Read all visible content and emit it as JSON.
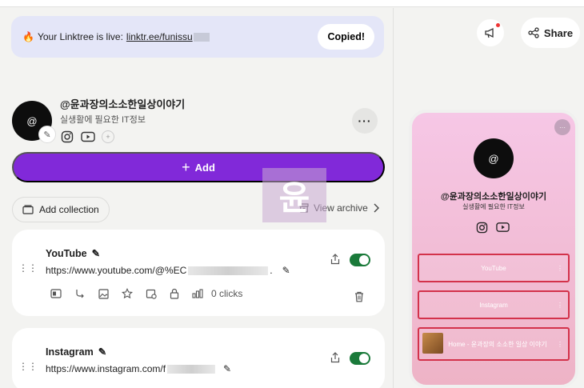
{
  "banner": {
    "prefix": "Your Linktree is live:",
    "link": "linktr.ee/funissu",
    "copied_label": "Copied!"
  },
  "profile": {
    "avatar_text": "@",
    "name": "@윤과장의소소한일상이야기",
    "bio": "실생활에 필요한 IT정보"
  },
  "actions": {
    "add_label": "Add",
    "collection_label": "Add collection",
    "archive_label": "View archive"
  },
  "links": [
    {
      "title": "YouTube",
      "url": "https://www.youtube.com/@%EC",
      "url_suffix": ".",
      "clicks": "0 clicks"
    },
    {
      "title": "Instagram",
      "url": "https://www.instagram.com/f"
    }
  ],
  "header": {
    "share_label": "Share"
  },
  "watermark": "윤",
  "preview": {
    "avatar_text": "@",
    "name": "@윤과장의소소한일상이야기",
    "bio": "실생활에 필요한 IT정보",
    "links": [
      {
        "label": "YouTube"
      },
      {
        "label": "Instagram"
      },
      {
        "label": "Home - 윤과장의 소소한 일상 이야기"
      }
    ]
  },
  "colors": {
    "accent": "#8129d9",
    "toggle_on": "#1a7a3a",
    "banner_bg": "#e4e6f8",
    "preview_border": "#d3324b"
  }
}
